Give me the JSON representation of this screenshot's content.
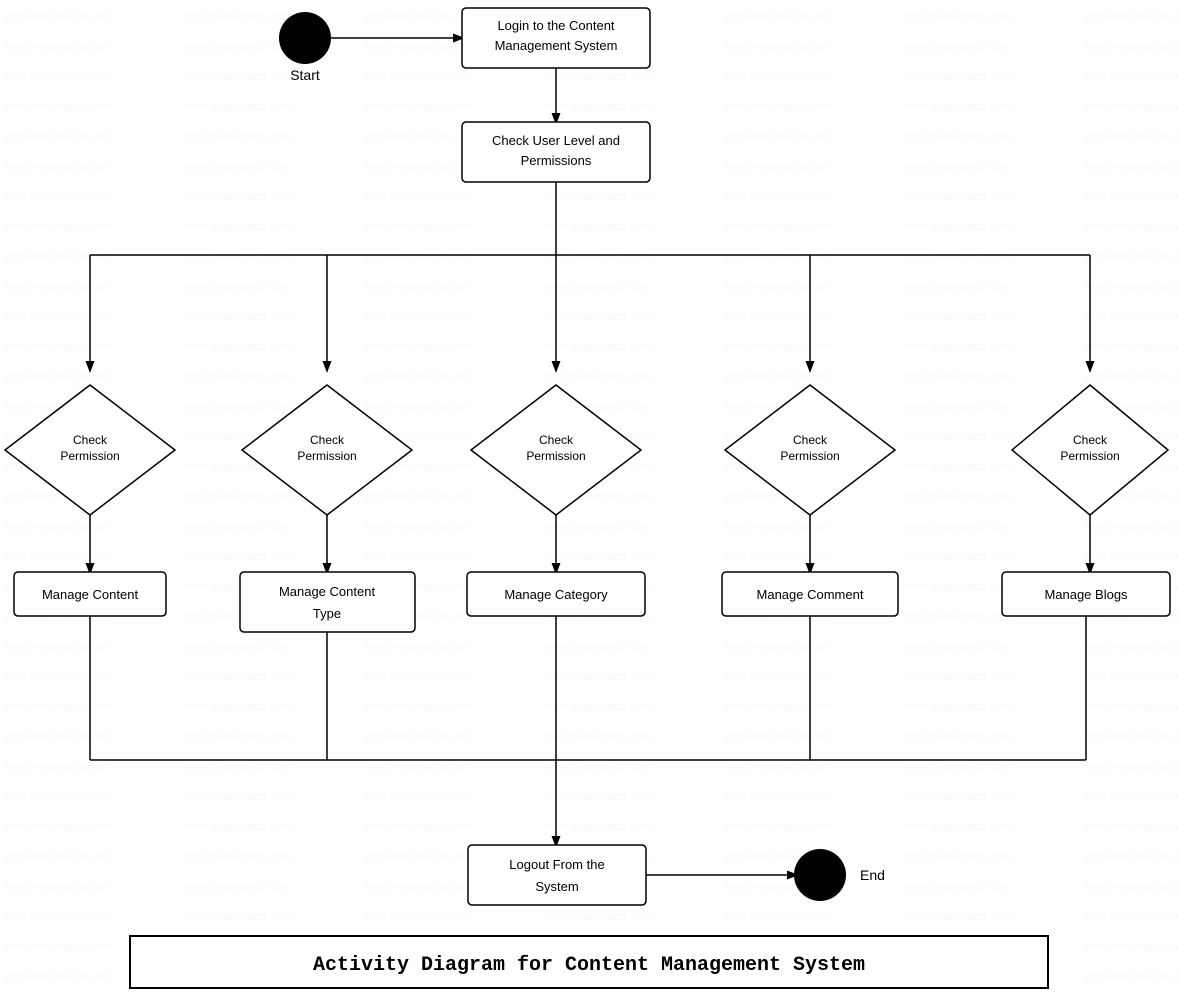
{
  "watermark": "www.freeprojectz.com",
  "title": "Activity Diagram for Content Management System",
  "nodes": {
    "start_label": "Start",
    "end_label": "End",
    "login": "Login to the Content\nManagement System",
    "check_user_level": "Check User Level and\nPermissions",
    "check_permission_1": "Check\nPermission",
    "check_permission_2": "Check\nPermission",
    "check_permission_3": "Check\nPermission",
    "check_permission_4": "Check\nPermission",
    "check_permission_5": "Check\nPermission",
    "manage_content": "Manage Content",
    "manage_content_type": "Manage Content\nType",
    "manage_category": "Manage Category",
    "manage_comment": "Manage Comment",
    "manage_blogs": "Manage Blogs",
    "logout": "Logout From the\nSystem"
  }
}
